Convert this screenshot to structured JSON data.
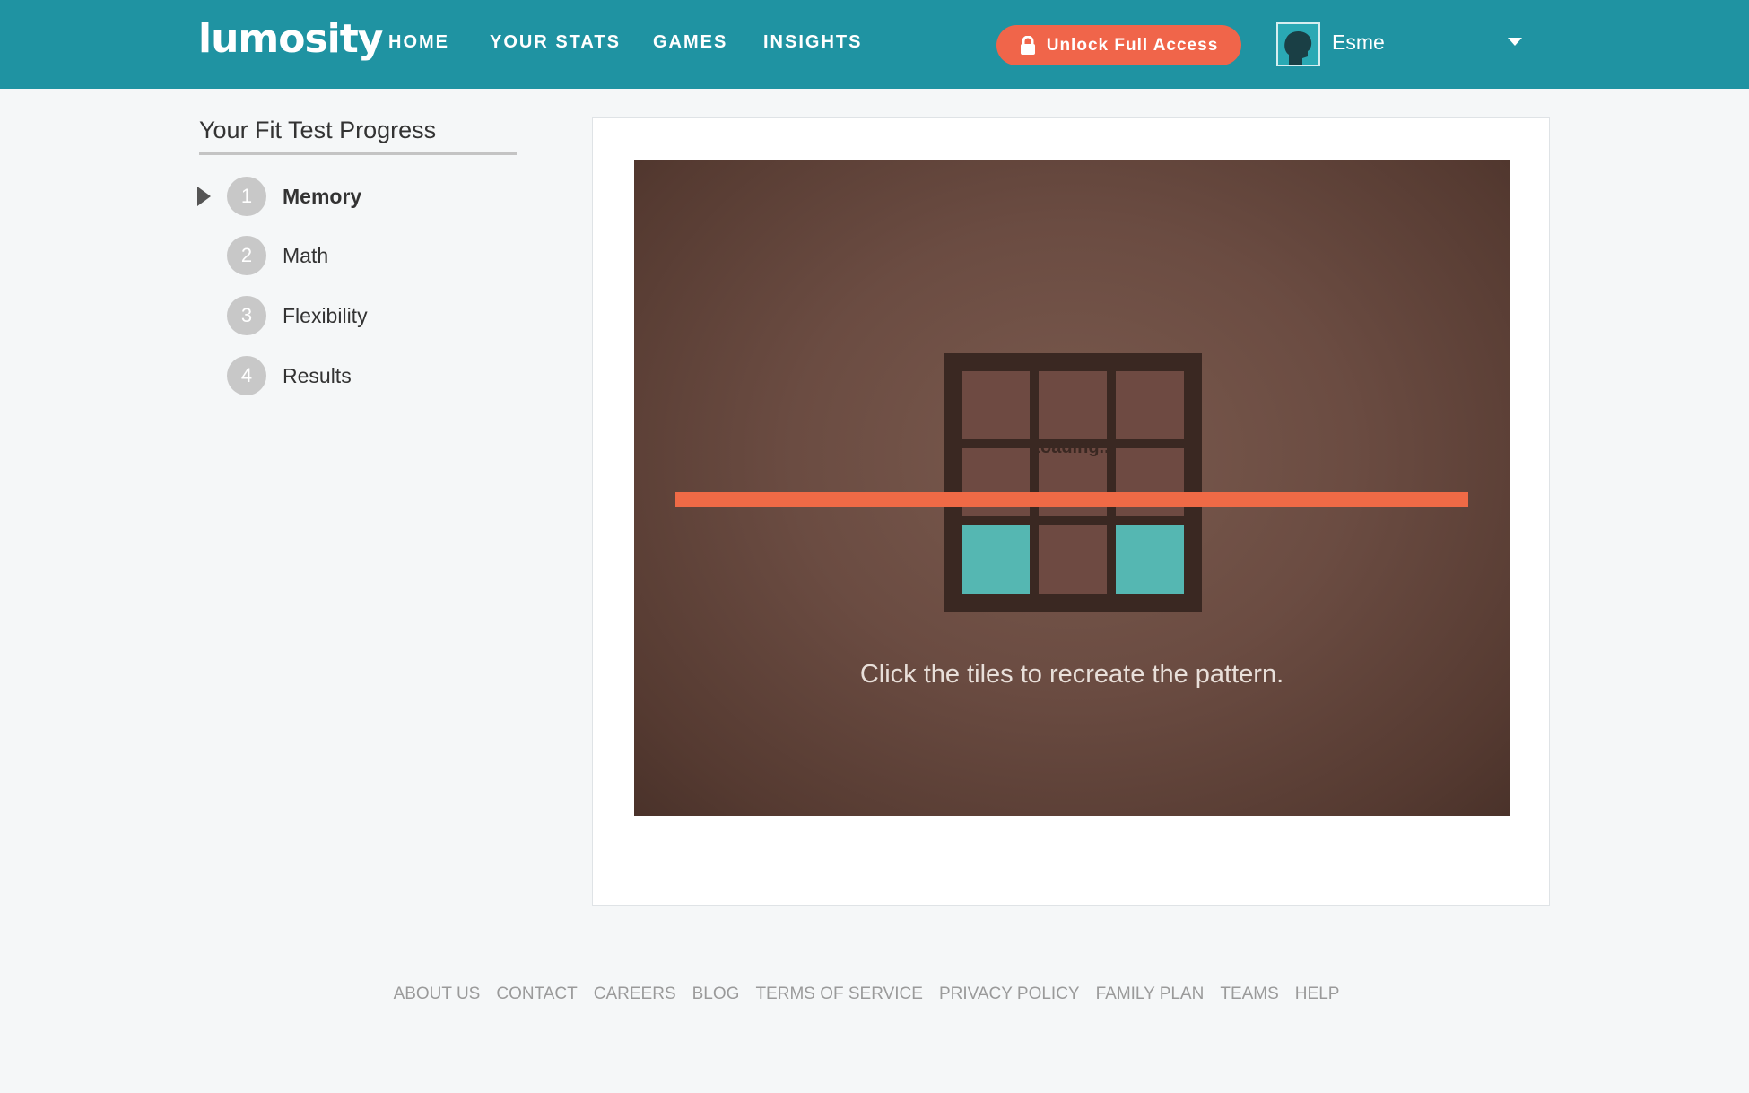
{
  "header": {
    "logo": "lumosity",
    "nav": [
      {
        "label": "HOME"
      },
      {
        "label": "YOUR STATS"
      },
      {
        "label": "GAMES"
      },
      {
        "label": "INSIGHTS"
      }
    ],
    "unlock_label": "Unlock Full Access",
    "username": "Esme",
    "icons": {
      "lock": "lock-icon",
      "avatar": "user-silhouette-icon",
      "dropdown": "chevron-down-icon"
    },
    "colors": {
      "bar": "#1f93a2",
      "accent": "#f0654a"
    }
  },
  "sidebar": {
    "title": "Your Fit Test Progress",
    "steps": [
      {
        "number": "1",
        "label": "Memory",
        "current": true
      },
      {
        "number": "2",
        "label": "Math",
        "current": false
      },
      {
        "number": "3",
        "label": "Flexibility",
        "current": false
      },
      {
        "number": "4",
        "label": "Results",
        "current": false
      }
    ]
  },
  "game": {
    "loading_text": "Loading...",
    "instruction": "Click the tiles to recreate the pattern.",
    "lit_tiles": [
      6,
      8
    ],
    "colors": {
      "tile": "#6e4a42",
      "lit_tile": "#55b7b2",
      "bar": "#ef6a46"
    }
  },
  "footer": {
    "links": [
      "ABOUT US",
      "CONTACT",
      "CAREERS",
      "BLOG",
      "TERMS OF SERVICE",
      "PRIVACY POLICY",
      "FAMILY PLAN",
      "TEAMS",
      "HELP"
    ]
  }
}
